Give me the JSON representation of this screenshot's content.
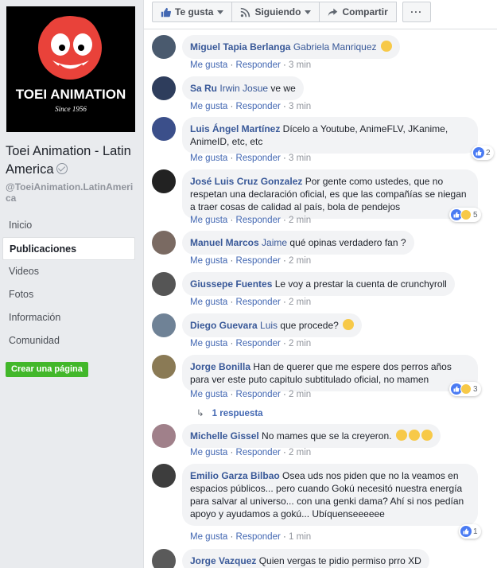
{
  "page": {
    "logo_text": "TOEI ANIMATION",
    "logo_since": "Since 1956",
    "name": "Toei Animation - Latin America",
    "handle": "@ToeiAnimation.LatinAmerica",
    "verified_icon": "verified-check-icon"
  },
  "nav": [
    "Inicio",
    "Publicaciones",
    "Videos",
    "Fotos",
    "Información",
    "Comunidad"
  ],
  "nav_active": "Publicaciones",
  "create_page_label": "Crear una página",
  "actions": {
    "like": "Te gusta",
    "follow": "Siguiendo",
    "share": "Compartir",
    "more": "···"
  },
  "meta_labels": {
    "like": "Me gusta",
    "reply": "Responder",
    "sep": " · "
  },
  "comments": [
    {
      "author": "Miguel Tapia Berlanga",
      "tag": "Gabriela Manriquez",
      "text": "",
      "emoji": "wink-tongue",
      "time": "3 min"
    },
    {
      "author": "Sa Ru",
      "tag": "Irwin Josue",
      "text": " ve we",
      "time": "3 min"
    },
    {
      "author": "Luis Ángel Martínez",
      "tag": "",
      "text": " Dícelo a Youtube, AnimeFLV, JKanime, AnimeID, etc, etc",
      "time": "3 min",
      "reactions": "2"
    },
    {
      "author": "José Luis Cruz Gonzalez",
      "tag": "",
      "text": " Por gente como ustedes, que no respetan una declaración oficial, es que las compañías se niegan a traer cosas de calidad al país, bola de pendejos",
      "time": "2 min",
      "reactions": "5"
    },
    {
      "author": "Manuel Marcos",
      "tag": "Jaime",
      "text": " qué opinas verdadero fan ?",
      "time": "2 min"
    },
    {
      "author": "Giussepe Fuentes",
      "tag": "",
      "text": " Le voy a prestar la cuenta de crunchyroll",
      "time": "2 min"
    },
    {
      "author": "Diego Guevara",
      "tag": "Luis",
      "text": " que procede?",
      "emoji": "worried",
      "time": "2 min"
    },
    {
      "author": "Jorge Bonilla",
      "tag": "",
      "text": " Han de querer que me espere dos perros años para ver este puto capitulo subtitulado oficial, no mamen",
      "time": "2 min",
      "reactions": "3",
      "replies": "1 respuesta"
    },
    {
      "author": "Michelle Gissel",
      "tag": "",
      "text": " No mames que se la creyeron.",
      "emoji": "laugh-x3",
      "time": "2 min"
    },
    {
      "author": "Emilio Garza Bilbao",
      "tag": "",
      "text": " Osea uds nos piden que no la veamos en espacios públicos... pero cuando Gokú necesitó nuestra energía para salvar al universo... con una genki dama? Ahí si nos pedían apoyo y ayudamos a gokú... Ubíquenseeeeee",
      "time": "1 min",
      "reactions": "1"
    },
    {
      "author": "Jorge Vazquez",
      "tag": "",
      "text": " Quien vergas te pidio permiso prro XD",
      "time": ""
    }
  ]
}
